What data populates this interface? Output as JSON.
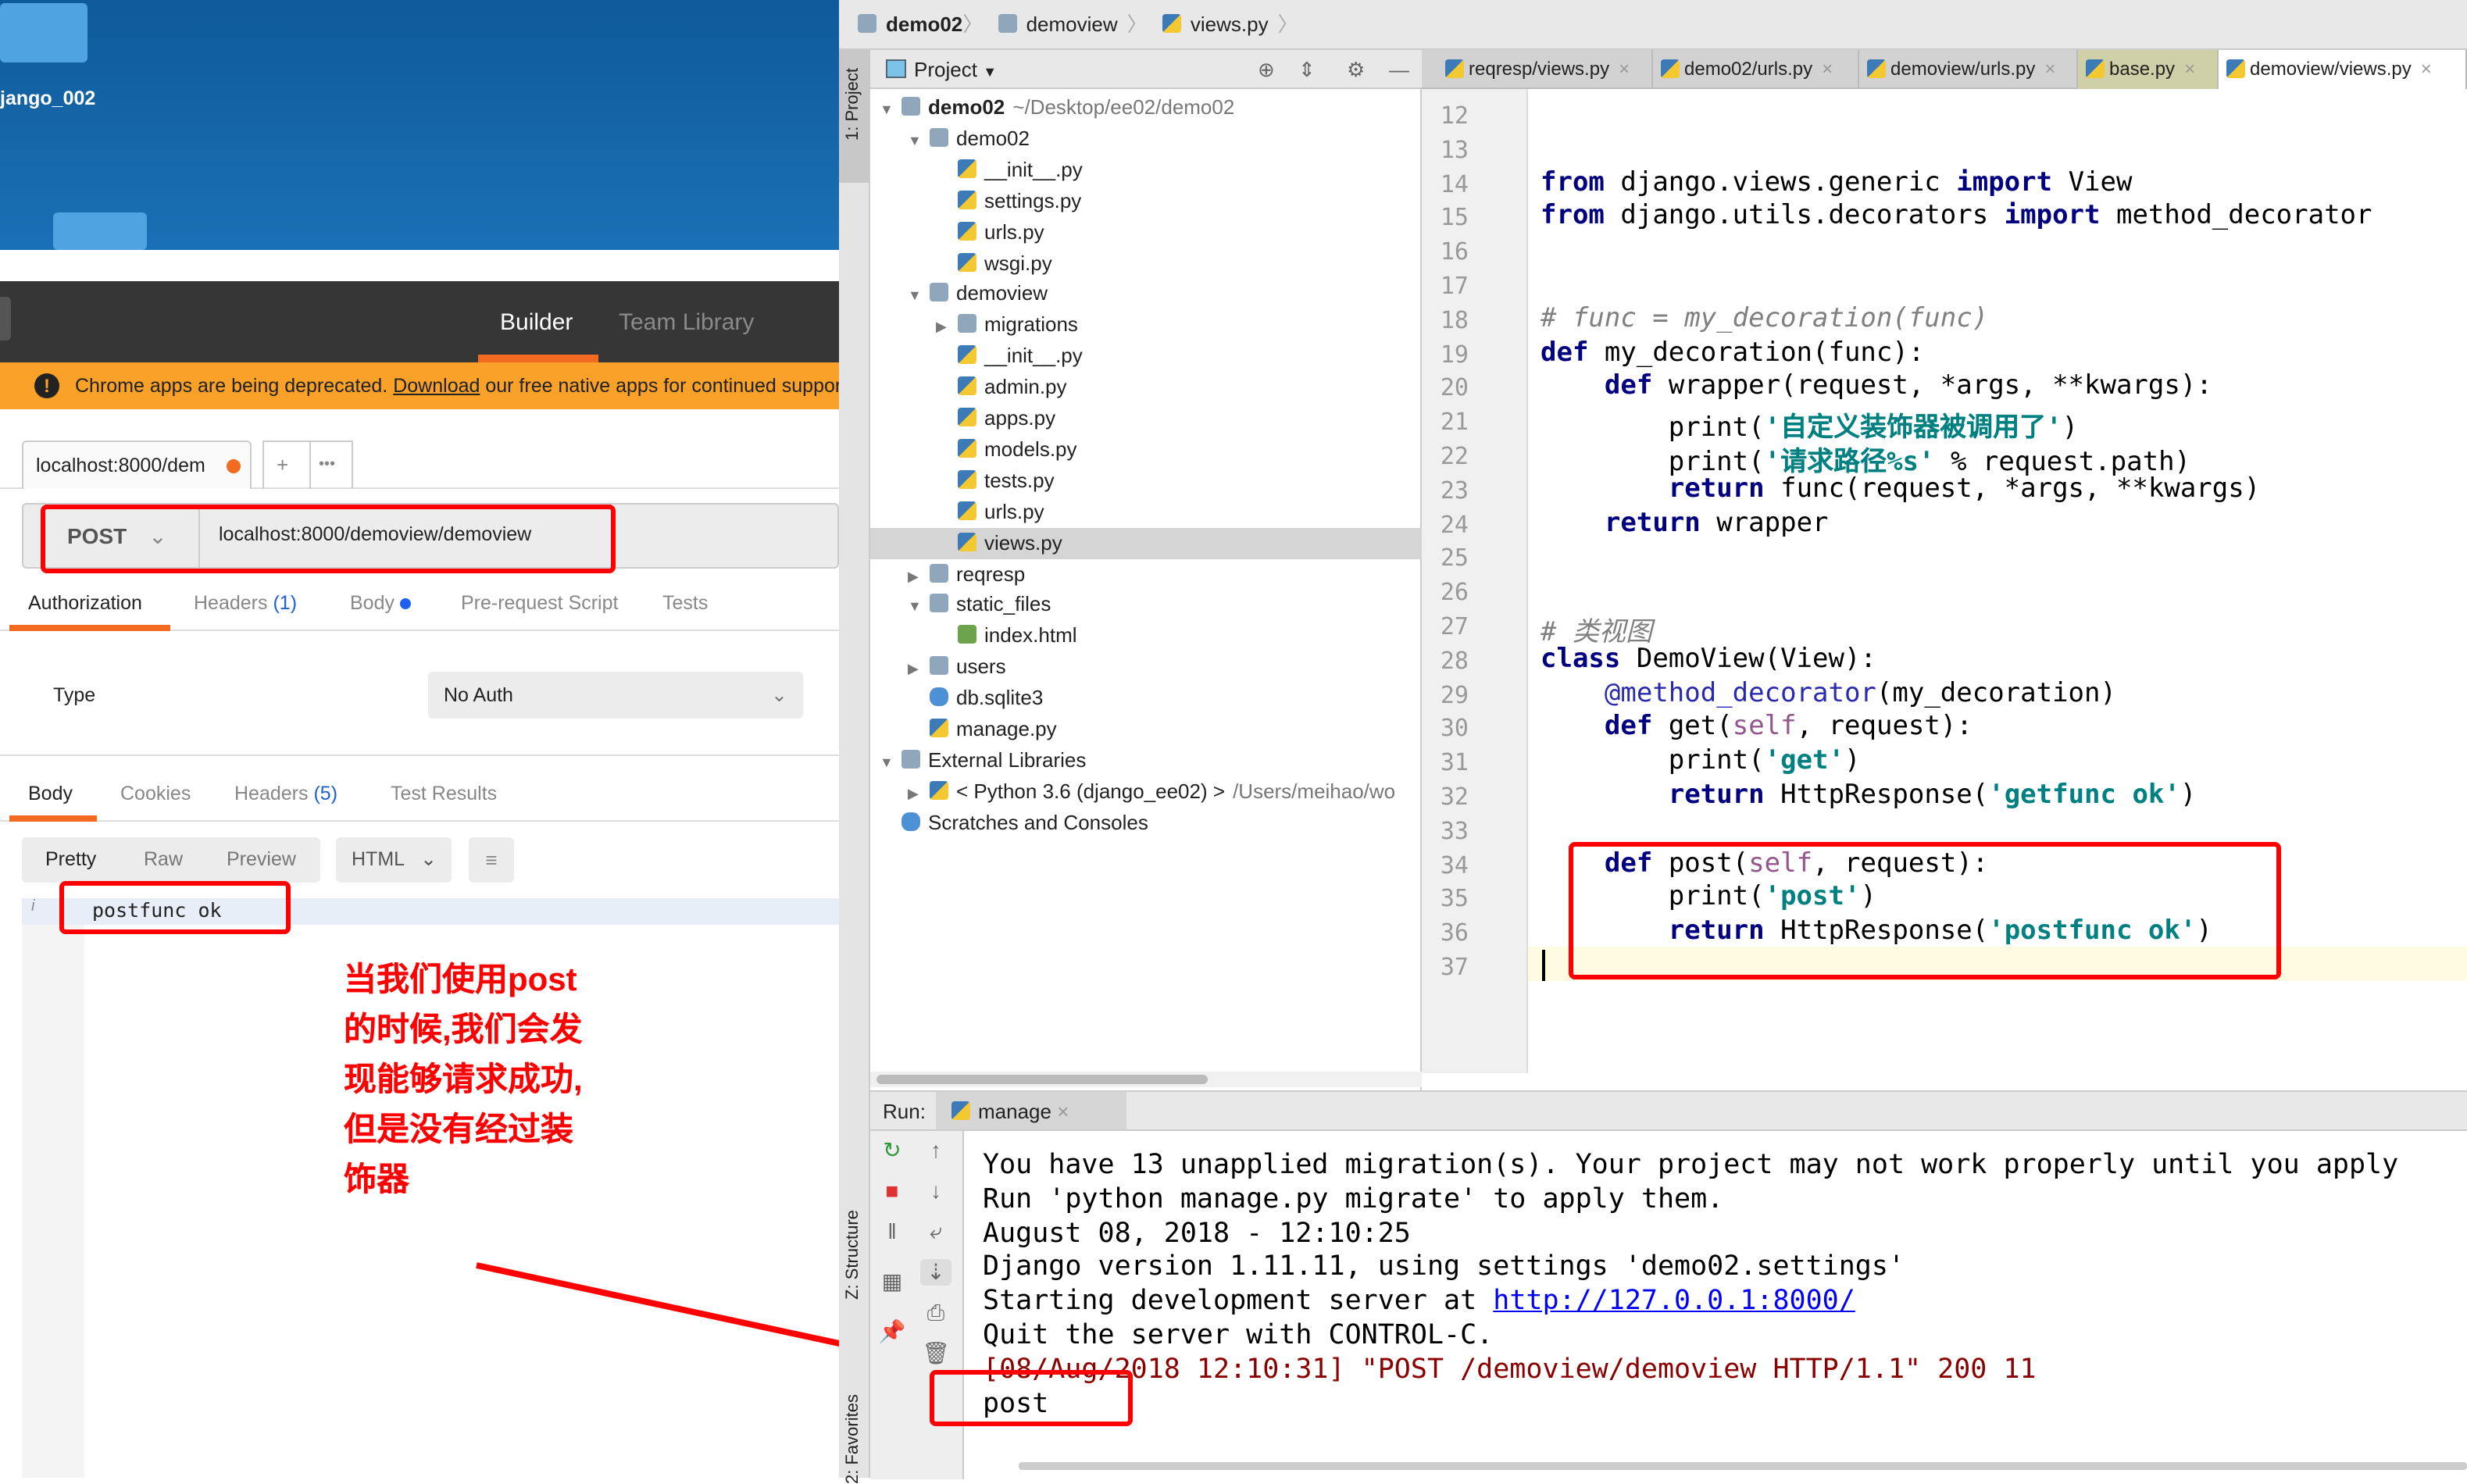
{
  "desktop": {
    "folder_label": "jango_002"
  },
  "postman": {
    "nav": {
      "builder": "Builder",
      "team_library": "Team Library"
    },
    "banner": {
      "text_before": "Chrome apps are being deprecated. ",
      "link": "Download",
      "text_after": " our free native apps for continued support"
    },
    "request_tab": "localhost:8000/dem",
    "new_tab": "+",
    "more": "•••",
    "method": "POST",
    "url": "localhost:8000/demoview/demoview",
    "req_tabs": [
      {
        "label": "Authorization"
      },
      {
        "label": "Headers",
        "count": "(1)"
      },
      {
        "label": "Body"
      },
      {
        "label": "Pre-request Script"
      },
      {
        "label": "Tests"
      }
    ],
    "auth": {
      "type_label": "Type",
      "type_value": "No Auth"
    },
    "resp_tabs": [
      {
        "label": "Body"
      },
      {
        "label": "Cookies"
      },
      {
        "label": "Headers",
        "count": "(5)"
      },
      {
        "label": "Test Results"
      }
    ],
    "view_modes": [
      "Pretty",
      "Raw",
      "Preview"
    ],
    "format": "HTML",
    "response_line": "postfunc ok",
    "annotation": "当我们使用post的时候,我们会发现能够请求成功,但是没有经过装饰器"
  },
  "ide": {
    "breadcrumb": [
      "demo02",
      "demoview",
      "views.py"
    ],
    "strip": {
      "project": "1: Project",
      "structure": "Z: Structure",
      "favorites": "2: Favorites"
    },
    "project_header": "Project",
    "tree": [
      {
        "label": "demo02",
        "suffix": "~/Desktop/ee02/demo02",
        "depth": 0,
        "arrow": "▼",
        "icon": "dir",
        "bold": true
      },
      {
        "label": "demo02",
        "depth": 1,
        "arrow": "▼",
        "icon": "dir"
      },
      {
        "label": "__init__.py",
        "depth": 2,
        "icon": "py"
      },
      {
        "label": "settings.py",
        "depth": 2,
        "icon": "py"
      },
      {
        "label": "urls.py",
        "depth": 2,
        "icon": "py"
      },
      {
        "label": "wsgi.py",
        "depth": 2,
        "icon": "py"
      },
      {
        "label": "demoview",
        "depth": 1,
        "arrow": "▼",
        "icon": "dir"
      },
      {
        "label": "migrations",
        "depth": 2,
        "arrow": "▶",
        "icon": "dir"
      },
      {
        "label": "__init__.py",
        "depth": 2,
        "icon": "py"
      },
      {
        "label": "admin.py",
        "depth": 2,
        "icon": "py"
      },
      {
        "label": "apps.py",
        "depth": 2,
        "icon": "py"
      },
      {
        "label": "models.py",
        "depth": 2,
        "icon": "py"
      },
      {
        "label": "tests.py",
        "depth": 2,
        "icon": "py"
      },
      {
        "label": "urls.py",
        "depth": 2,
        "icon": "py"
      },
      {
        "label": "views.py",
        "depth": 2,
        "icon": "py",
        "selected": true
      },
      {
        "label": "reqresp",
        "depth": 1,
        "arrow": "▶",
        "icon": "dir"
      },
      {
        "label": "static_files",
        "depth": 1,
        "arrow": "▼",
        "icon": "dir"
      },
      {
        "label": "index.html",
        "depth": 2,
        "icon": "html"
      },
      {
        "label": "users",
        "depth": 1,
        "arrow": "▶",
        "icon": "dir"
      },
      {
        "label": "db.sqlite3",
        "depth": 1,
        "icon": "db"
      },
      {
        "label": "manage.py",
        "depth": 1,
        "icon": "py"
      },
      {
        "label": "External Libraries",
        "depth": 0,
        "arrow": "▼",
        "icon": "lib"
      },
      {
        "label": "< Python 3.6 (django_ee02) >",
        "suffix": "/Users/meihao/wo",
        "depth": 1,
        "arrow": "▶",
        "icon": "py"
      },
      {
        "label": "Scratches and Consoles",
        "depth": 0,
        "icon": "db"
      }
    ],
    "tabs": [
      "reqresp/views.py",
      "demo02/urls.py",
      "demoview/urls.py",
      "base.py",
      "demoview/views.py"
    ],
    "active_tab": "demoview/views.py",
    "code": [
      {
        "n": "12",
        "t": []
      },
      {
        "n": "13",
        "t": []
      },
      {
        "n": "14",
        "t": [
          [
            "from",
            "kw"
          ],
          [
            " django.views.generic ",
            ""
          ],
          [
            "import",
            "kw"
          ],
          [
            " View",
            ""
          ]
        ]
      },
      {
        "n": "15",
        "t": [
          [
            "from",
            "kw"
          ],
          [
            " django.utils.decorators ",
            ""
          ],
          [
            "import",
            "kw"
          ],
          [
            " method_decorator",
            ""
          ]
        ]
      },
      {
        "n": "16",
        "t": []
      },
      {
        "n": "17",
        "t": []
      },
      {
        "n": "18",
        "t": [
          [
            "# func = my_decoration(func)",
            "cm"
          ]
        ]
      },
      {
        "n": "19",
        "t": [
          [
            "def",
            "kw"
          ],
          [
            " my_decoration(func):",
            ""
          ]
        ]
      },
      {
        "n": "20",
        "t": [
          [
            "    ",
            ""
          ],
          [
            "def",
            "kw"
          ],
          [
            " wrapper(request, *args, **kwargs):",
            ""
          ]
        ]
      },
      {
        "n": "21",
        "t": [
          [
            "        print(",
            ""
          ],
          [
            "'自定义装饰器被调用了'",
            "cjk"
          ],
          [
            ")",
            ""
          ]
        ]
      },
      {
        "n": "22",
        "t": [
          [
            "        print(",
            ""
          ],
          [
            "'请求路径%s'",
            "cjk"
          ],
          [
            " % request.path)",
            ""
          ]
        ]
      },
      {
        "n": "23",
        "t": [
          [
            "        ",
            ""
          ],
          [
            "return",
            "kw"
          ],
          [
            " func(request, *args, **kwargs)",
            ""
          ]
        ]
      },
      {
        "n": "24",
        "t": [
          [
            "    ",
            ""
          ],
          [
            "return",
            "kw"
          ],
          [
            " wrapper",
            ""
          ]
        ]
      },
      {
        "n": "25",
        "t": []
      },
      {
        "n": "26",
        "t": []
      },
      {
        "n": "27",
        "t": [
          [
            "# 类视图",
            "cm"
          ]
        ]
      },
      {
        "n": "28",
        "t": [
          [
            "class",
            "kw"
          ],
          [
            " DemoView(View):",
            ""
          ]
        ]
      },
      {
        "n": "29",
        "t": [
          [
            "    ",
            ""
          ],
          [
            "@method_decorator",
            "dec"
          ],
          [
            "(my_decoration)",
            ""
          ]
        ]
      },
      {
        "n": "30",
        "t": [
          [
            "    ",
            ""
          ],
          [
            "def",
            "kw"
          ],
          [
            " get(",
            ""
          ],
          [
            "self",
            "self"
          ],
          [
            ", request):",
            ""
          ]
        ]
      },
      {
        "n": "31",
        "t": [
          [
            "        print(",
            ""
          ],
          [
            "'get'",
            "st"
          ],
          [
            ")",
            ""
          ]
        ]
      },
      {
        "n": "32",
        "t": [
          [
            "        ",
            ""
          ],
          [
            "return",
            "kw"
          ],
          [
            " HttpResponse(",
            ""
          ],
          [
            "'getfunc ok'",
            "st"
          ],
          [
            ")",
            ""
          ]
        ]
      },
      {
        "n": "33",
        "t": []
      },
      {
        "n": "34",
        "t": [
          [
            "    ",
            ""
          ],
          [
            "def",
            "kw"
          ],
          [
            " post(",
            ""
          ],
          [
            "self",
            "self"
          ],
          [
            ", request):",
            ""
          ]
        ]
      },
      {
        "n": "35",
        "t": [
          [
            "        print(",
            ""
          ],
          [
            "'post'",
            "st"
          ],
          [
            ")",
            ""
          ]
        ]
      },
      {
        "n": "36",
        "t": [
          [
            "        ",
            ""
          ],
          [
            "return",
            "kw"
          ],
          [
            " HttpResponse(",
            ""
          ],
          [
            "'postfunc ok'",
            "st"
          ],
          [
            ")",
            ""
          ]
        ]
      },
      {
        "n": "37",
        "t": []
      }
    ],
    "run": {
      "label": "Run:",
      "tab": "manage",
      "console": [
        {
          "text": "You have 13 unapplied migration(s). Your project may not work properly until you apply"
        },
        {
          "text": "Run 'python manage.py migrate' to apply them."
        },
        {
          "text": "August 08, 2018 - 12:10:25"
        },
        {
          "text": "Django version 1.11.11, using settings 'demo02.settings'"
        },
        {
          "text": "Starting development server at ",
          "link": "http://127.0.0.1:8000/"
        },
        {
          "text": "Quit the server with CONTROL-C."
        },
        {
          "text": "[08/Aug/2018 12:10:31] \"POST /demoview/demoview HTTP/1.1\" 200 11",
          "style": "err"
        },
        {
          "text": "post"
        }
      ]
    },
    "colors": {
      "accent_orange": "#f26b21",
      "banner": "#f9a128",
      "annotation_red": "#ff0000",
      "keyword": "#000080",
      "string": "#008080"
    }
  }
}
